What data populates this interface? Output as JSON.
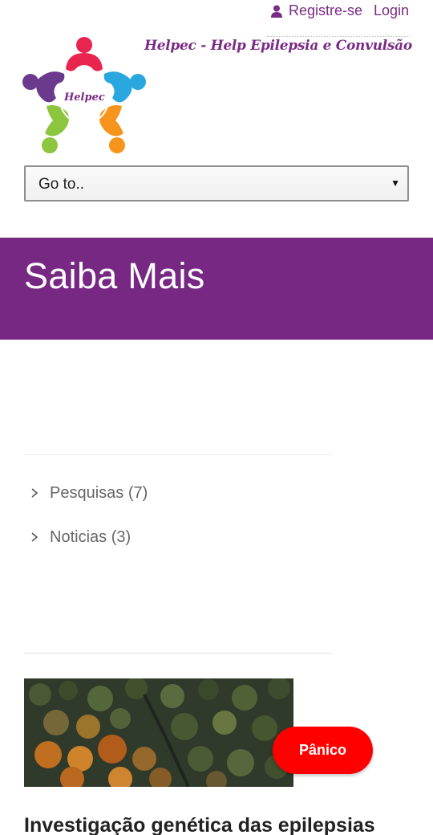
{
  "header": {
    "register_label": "Registre-se",
    "login_label": "Login",
    "tagline": "Helpec - Help Epilepsia e Convulsão",
    "logo_text": "Helpec"
  },
  "nav": {
    "select_value": "Go to.."
  },
  "banner": {
    "title": "Saiba Mais",
    "color": "#762883"
  },
  "categories": [
    {
      "label": "Pesquisas (7)"
    },
    {
      "label": "Noticias (3)"
    }
  ],
  "panic_button": {
    "label": "Pânico",
    "color": "#ff0000"
  },
  "article": {
    "title": "Investigação genética das epilepsias"
  },
  "colors": {
    "accent": "#7a2b84"
  },
  "icons": [
    "user-icon",
    "chevron-right-icon",
    "dropdown-arrow-icon"
  ]
}
